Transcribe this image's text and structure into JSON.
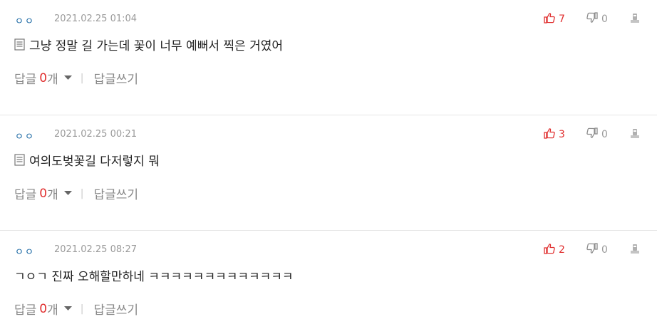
{
  "colors": {
    "author": "#0d5f9e",
    "date": "#9a9a9a",
    "like": "#e02f2f",
    "dislike": "#9a9a9a",
    "reply_count": "#e02f2f",
    "divider": "#e5e5e5"
  },
  "comments": [
    {
      "author": "ㅇㅇ",
      "date": "2021.02.25 01:04",
      "likes": "7",
      "dislikes": "0",
      "has_doc_icon": true,
      "text": "그냥 정말 길 가는데 꽃이 너무 예뻐서 찍은 거였어",
      "reply_label": "답글",
      "reply_count": "0",
      "reply_unit": "개",
      "write_reply_label": "답글쓰기",
      "separator": "|"
    },
    {
      "author": "ㅇㅇ",
      "date": "2021.02.25 00:21",
      "likes": "3",
      "dislikes": "0",
      "has_doc_icon": true,
      "text": "여의도벚꽃길 다저렇지 뭐",
      "reply_label": "답글",
      "reply_count": "0",
      "reply_unit": "개",
      "write_reply_label": "답글쓰기",
      "separator": "|"
    },
    {
      "author": "ㅇㅇ",
      "date": "2021.02.25 08:27",
      "likes": "2",
      "dislikes": "0",
      "has_doc_icon": false,
      "text": "ㄱㅇㄱ 진짜 오해할만하네 ㅋㅋㅋㅋㅋㅋㅋㅋㅋㅋㅋㅋㅋ",
      "reply_label": "답글",
      "reply_count": "0",
      "reply_unit": "개",
      "write_reply_label": "답글쓰기",
      "separator": "|"
    }
  ],
  "icons": {
    "like": "thumbs-up-icon",
    "dislike": "thumbs-down-icon",
    "report": "report-icon",
    "document": "document-icon",
    "caret": "caret-down-icon"
  }
}
